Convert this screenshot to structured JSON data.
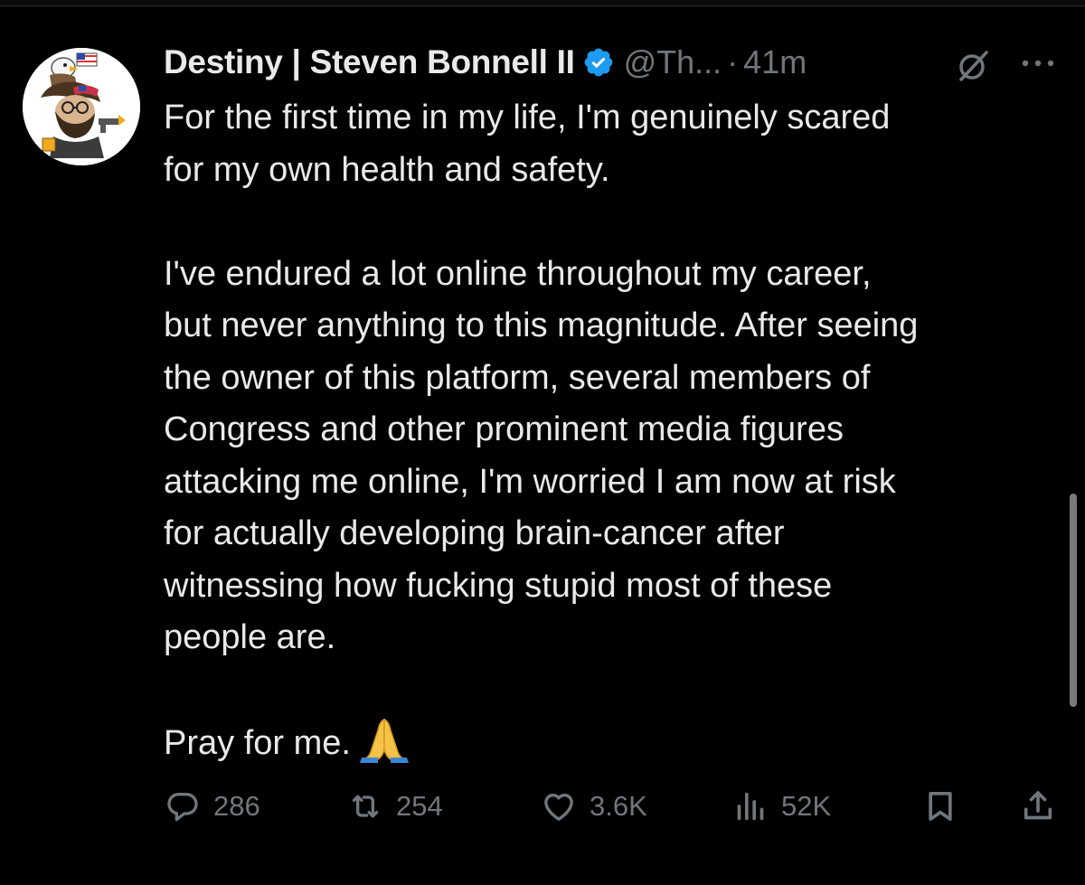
{
  "tweet": {
    "display_name": "Destiny | Steven Bonnell II",
    "handle": "@Th...",
    "separator": "·",
    "timestamp": "41m",
    "lines": [
      "For the first time in my life, I'm genuinely scared",
      "for my own health and safety.",
      "",
      "I've endured a lot online throughout my career,",
      "but never anything to this magnitude. After seeing",
      "the owner of this platform, several members of",
      "Congress and other prominent media figures",
      "attacking me online, I'm worried I am now at risk",
      "for actually developing brain-cancer after",
      "witnessing how fucking stupid most of these",
      "people are.",
      "",
      ""
    ],
    "last_line": "Pray for me.",
    "last_line_emoji": "pray-emoji"
  },
  "actions": {
    "replies": "286",
    "reposts": "254",
    "likes": "3.6K",
    "views": "52K"
  },
  "icons": {
    "verified": "verified-badge-icon",
    "grok": "grok-icon",
    "more": "more-icon",
    "reply": "reply-icon",
    "repost": "repost-icon",
    "like": "heart-icon",
    "views": "views-icon",
    "bookmark": "bookmark-icon",
    "share": "share-icon"
  },
  "colors": {
    "background": "#000000",
    "text_primary": "#e7e9ea",
    "text_secondary": "#71767b",
    "verified_blue": "#1d9bf0"
  }
}
